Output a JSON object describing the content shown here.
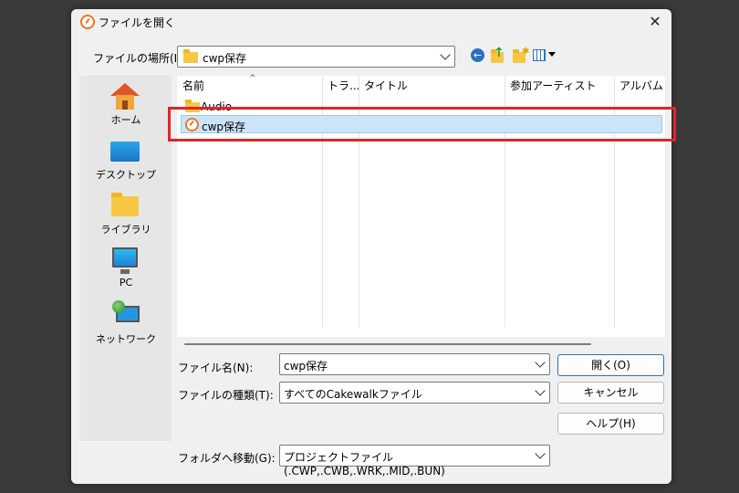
{
  "dialog": {
    "title": "ファイルを開く",
    "close_glyph": "✕"
  },
  "location": {
    "label": "ファイルの場所(I):",
    "value": "cwp保存"
  },
  "toolbar": {
    "back_icon": "back-arrow-icon",
    "up_icon": "up-folder-icon",
    "new_folder_icon": "new-folder-icon",
    "view_icon": "view-menu-icon"
  },
  "places": [
    {
      "label": "ホーム",
      "icon": "home-icon"
    },
    {
      "label": "デスクトップ",
      "icon": "desktop-icon"
    },
    {
      "label": "ライブラリ",
      "icon": "library-icon"
    },
    {
      "label": "PC",
      "icon": "pc-icon"
    },
    {
      "label": "ネットワーク",
      "icon": "network-icon"
    }
  ],
  "columns": [
    "名前",
    "トラ...",
    "タイトル",
    "参加アーティスト",
    "アルバム"
  ],
  "files": [
    {
      "name": "Audio",
      "type": "folder",
      "selected": false
    },
    {
      "name": "cwp保存",
      "type": "cakewalk-project",
      "selected": true
    }
  ],
  "form": {
    "filename_label": "ファイル名(N):",
    "filename_value": "cwp保存",
    "filetype_label": "ファイルの種類(T):",
    "filetype_value": "すべてのCakewalkファイル",
    "goto_label": "フォルダへ移動(G):",
    "goto_value": "プロジェクトファイル (.CWP,.CWB,.WRK,.MID,.BUN)"
  },
  "buttons": {
    "open": "開く(O)",
    "cancel": "キャンセル",
    "help": "ヘルプ(H)"
  },
  "colors": {
    "highlight": "#e0242c",
    "selection": "#cce4f7",
    "accent": "#2f6fc2"
  }
}
